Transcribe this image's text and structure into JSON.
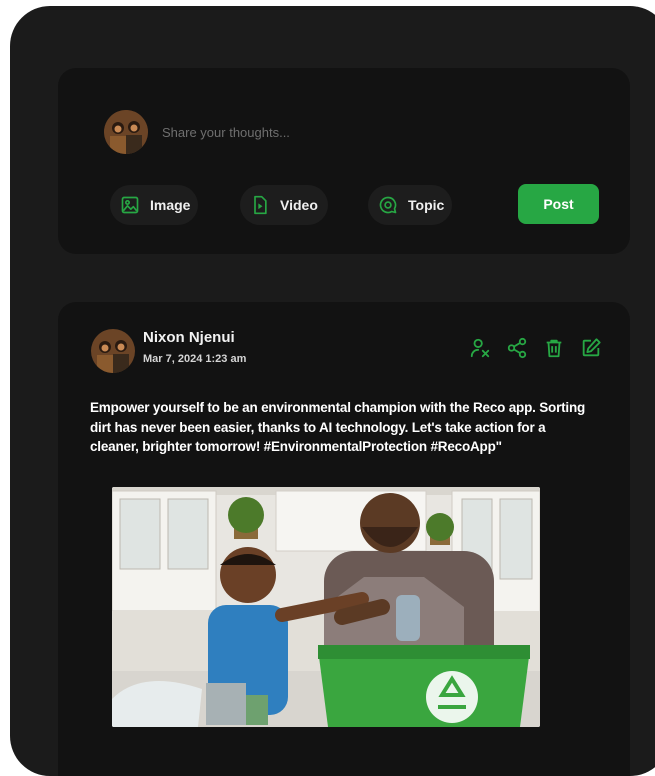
{
  "composer": {
    "placeholder": "Share your thoughts...",
    "buttons": {
      "image": "Image",
      "video": "Video",
      "topic": "Topic",
      "post": "Post"
    }
  },
  "post": {
    "author": "Nixon Njenui",
    "date": "Mar 7, 2024 1:23 am",
    "text": "Empower yourself to be an environmental champion with the Reco app. Sorting dirt has never been easier, thanks to AI technology. Let's take action for a cleaner, brighter tomorrow! #EnvironmentalProtection #RecoApp\"",
    "actions": [
      "add-user-icon",
      "share-icon",
      "trash-icon",
      "edit-icon"
    ]
  },
  "colors": {
    "accent": "#27a744",
    "background": "#1b1b1b",
    "card": "#121212"
  }
}
